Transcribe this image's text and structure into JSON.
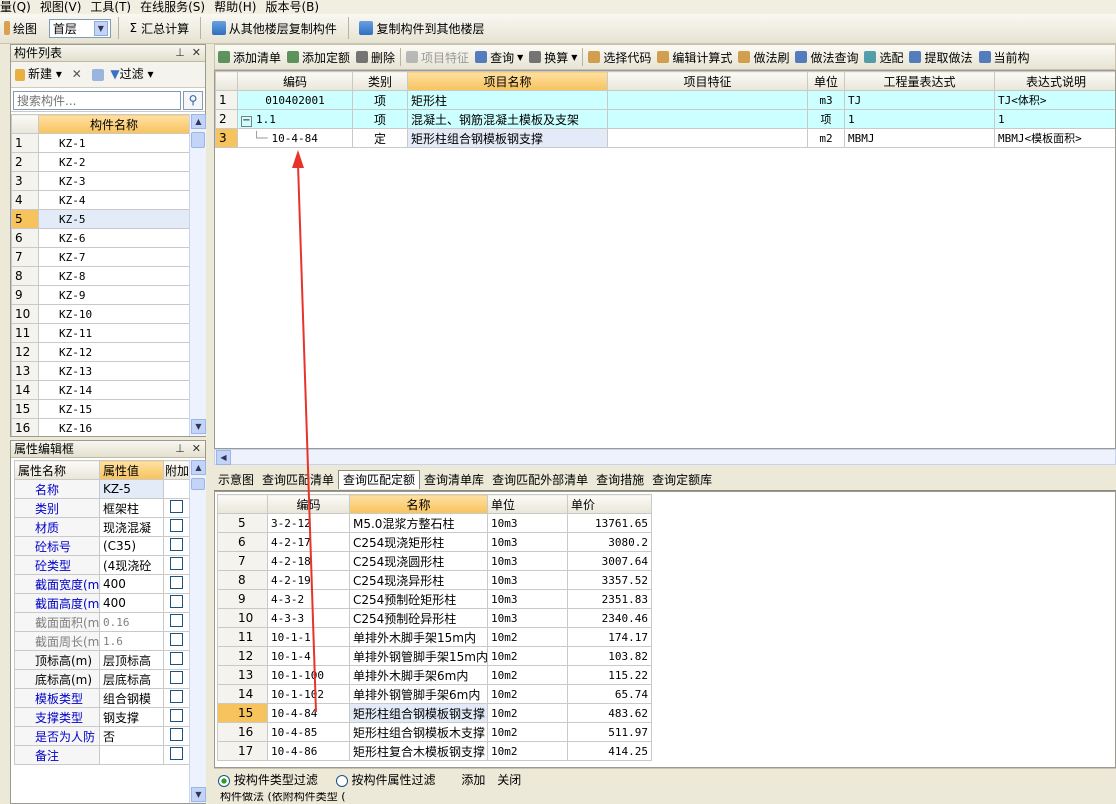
{
  "menu": [
    "量(Q)",
    "视图(V)",
    "工具(T)",
    "在线服务(S)",
    "帮助(H)",
    "版本号(B)"
  ],
  "toolbar1": {
    "draw_label": "绘图",
    "floor_value": "首层",
    "summary_label": "汇总计算",
    "copy_from_label": "从其他楼层复制构件",
    "copy_to_label": "复制构件到其他楼层"
  },
  "component_panel": {
    "title": "构件列表",
    "new_label": "新建",
    "filter_label": "过滤",
    "search_placeholder": "搜索构件...",
    "header": "构件名称",
    "items": [
      "KZ-1",
      "KZ-2",
      "KZ-3",
      "KZ-4",
      "KZ-5",
      "KZ-6",
      "KZ-7",
      "KZ-8",
      "KZ-9",
      "KZ-10",
      "KZ-11",
      "KZ-12",
      "KZ-13",
      "KZ-14",
      "KZ-15",
      "KZ-16"
    ],
    "selected_index": 5
  },
  "property_panel": {
    "title": "属性编辑框",
    "headers": [
      "属性名称",
      "属性值",
      "附加"
    ],
    "rows": [
      {
        "name": "名称",
        "value": "KZ-5",
        "blue": true
      },
      {
        "name": "类别",
        "value": "框架柱",
        "blue": true
      },
      {
        "name": "材质",
        "value": "现浇混凝",
        "blue": true
      },
      {
        "name": "砼标号",
        "value": "(C35)",
        "blue": true
      },
      {
        "name": "砼类型",
        "value": "(4现浇砼",
        "blue": true
      },
      {
        "name": "截面宽度(m",
        "value": "400",
        "blue": true
      },
      {
        "name": "截面高度(m",
        "value": "400",
        "blue": true
      },
      {
        "name": "截面面积(m",
        "value": "0.16",
        "blue": false
      },
      {
        "name": "截面周长(m",
        "value": "1.6",
        "blue": false
      },
      {
        "name": "顶标高(m)",
        "value": "层顶标高",
        "blue": false
      },
      {
        "name": "底标高(m)",
        "value": "层底标高",
        "blue": false
      },
      {
        "name": "模板类型",
        "value": "组合钢模",
        "blue": true
      },
      {
        "name": "支撑类型",
        "value": "钢支撑",
        "blue": true
      },
      {
        "name": "是否为人防",
        "value": "否",
        "blue": true
      },
      {
        "name": "备注",
        "value": "",
        "blue": true
      }
    ]
  },
  "main_toolbar": [
    "添加清单",
    "添加定额",
    "删除",
    "项目特征",
    "查询",
    "换算",
    "选择代码",
    "编辑计算式",
    "做法刷",
    "做法查询",
    "选配",
    "提取做法",
    "当前构"
  ],
  "top_table": {
    "headers": [
      "编码",
      "类别",
      "项目名称",
      "项目特征",
      "单位",
      "工程量表达式",
      "表达式说明"
    ],
    "rows": [
      {
        "num": "1",
        "code": "010402001",
        "type": "项",
        "name": "矩形柱",
        "feature": "",
        "unit": "m3",
        "expr": "TJ",
        "desc": "TJ<体积>",
        "tree": ""
      },
      {
        "num": "2",
        "code": "1.1",
        "type": "项",
        "name": "混凝土、钢筋混凝土模板及支架",
        "feature": "",
        "unit": "项",
        "expr": "1",
        "desc": "1",
        "tree": "−"
      },
      {
        "num": "3",
        "code": "10-4-84",
        "type": "定",
        "name": "矩形柱组合钢模板钢支撑",
        "feature": "",
        "unit": "m2",
        "expr": "MBMJ",
        "desc": "MBMJ<模板面积>",
        "tree": ""
      }
    ]
  },
  "bottom_tabs": [
    "示意图",
    "查询匹配清单",
    "查询匹配定额",
    "查询清单库",
    "查询匹配外部清单",
    "查询措施",
    "查询定额库"
  ],
  "bottom_active_tab": 2,
  "bottom_table": {
    "headers": [
      "编码",
      "名称",
      "单位",
      "单价"
    ],
    "rows": [
      {
        "num": "5",
        "code": "3-2-12",
        "name": "M5.0混浆方整石柱",
        "unit": "10m3",
        "price": "13761.65"
      },
      {
        "num": "6",
        "code": "4-2-17",
        "name": "C254现浇矩形柱",
        "unit": "10m3",
        "price": "3080.2"
      },
      {
        "num": "7",
        "code": "4-2-18",
        "name": "C254现浇圆形柱",
        "unit": "10m3",
        "price": "3007.64"
      },
      {
        "num": "8",
        "code": "4-2-19",
        "name": "C254现浇异形柱",
        "unit": "10m3",
        "price": "3357.52"
      },
      {
        "num": "9",
        "code": "4-3-2",
        "name": "C254预制砼矩形柱",
        "unit": "10m3",
        "price": "2351.83"
      },
      {
        "num": "10",
        "code": "4-3-3",
        "name": "C254预制砼异形柱",
        "unit": "10m3",
        "price": "2340.46"
      },
      {
        "num": "11",
        "code": "10-1-1",
        "name": "单排外木脚手架15m内",
        "unit": "10m2",
        "price": "174.17"
      },
      {
        "num": "12",
        "code": "10-1-4",
        "name": "单排外钢管脚手架15m内",
        "unit": "10m2",
        "price": "103.82"
      },
      {
        "num": "13",
        "code": "10-1-100",
        "name": "单排外木脚手架6m内",
        "unit": "10m2",
        "price": "115.22"
      },
      {
        "num": "14",
        "code": "10-1-102",
        "name": "单排外钢管脚手架6m内",
        "unit": "10m2",
        "price": "65.74"
      },
      {
        "num": "15",
        "code": "10-4-84",
        "name": "矩形柱组合钢模板钢支撑",
        "unit": "10m2",
        "price": "483.62"
      },
      {
        "num": "16",
        "code": "10-4-85",
        "name": "矩形柱组合钢模板木支撑",
        "unit": "10m2",
        "price": "511.97"
      },
      {
        "num": "17",
        "code": "10-4-86",
        "name": "矩形柱复合木模板钢支撑",
        "unit": "10m2",
        "price": "414.25"
      }
    ],
    "selected_num": "15"
  },
  "filter_bar": {
    "option1": "按构件类型过滤",
    "option2": "按构件属性过滤",
    "add": "添加",
    "close": "关闭"
  },
  "bottom_status": "构件做法 (依附构件类型 (",
  "colors": {
    "accent_orange": "#f7c35c",
    "highlight_cyan": "#ccffff",
    "arrow_red": "#e8332b"
  }
}
